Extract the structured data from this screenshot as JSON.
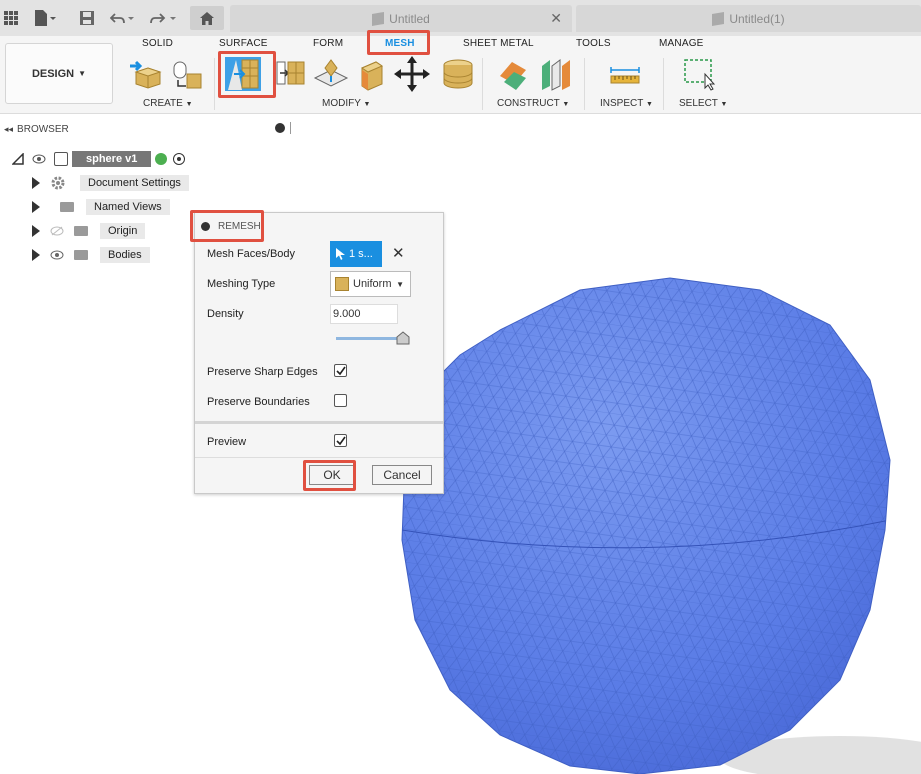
{
  "titlebar": {
    "tabs": [
      {
        "label": "Untitled"
      },
      {
        "label": "Untitled(1)"
      }
    ]
  },
  "toolbar": {
    "workspace_button": "DESIGN",
    "tabs": [
      {
        "label": "SOLID"
      },
      {
        "label": "SURFACE"
      },
      {
        "label": "FORM"
      },
      {
        "label": "MESH",
        "active": true
      },
      {
        "label": "SHEET METAL"
      },
      {
        "label": "TOOLS"
      },
      {
        "label": "MANAGE"
      }
    ],
    "groups": {
      "create": "CREATE",
      "modify": "MODIFY",
      "construct": "CONSTRUCT",
      "inspect": "INSPECT",
      "select": "SELECT"
    }
  },
  "browser": {
    "header": "BROWSER",
    "root": "sphere v1",
    "items": [
      {
        "label": "Document Settings",
        "icon": "gear-icon"
      },
      {
        "label": "Named Views",
        "icon": "folder-icon"
      },
      {
        "label": "Origin",
        "icon": "folder-icon"
      },
      {
        "label": "Bodies",
        "icon": "folder-icon"
      }
    ]
  },
  "remesh": {
    "title": "REMESH",
    "mesh_faces_label": "Mesh Faces/Body",
    "mesh_faces_value": "1 s...",
    "meshing_type_label": "Meshing Type",
    "meshing_type_value": "Uniform",
    "density_label": "Density",
    "density_value": "9.000",
    "density_slider": 1.0,
    "preserve_sharp_label": "Preserve Sharp Edges",
    "preserve_sharp_checked": true,
    "preserve_boundaries_label": "Preserve Boundaries",
    "preserve_boundaries_checked": false,
    "preview_label": "Preview",
    "preview_checked": true,
    "ok": "OK",
    "cancel": "Cancel"
  },
  "colors": {
    "accent": "#1a8fe0",
    "highlight": "#e05040",
    "mesh_body": "#5b7fe8"
  }
}
